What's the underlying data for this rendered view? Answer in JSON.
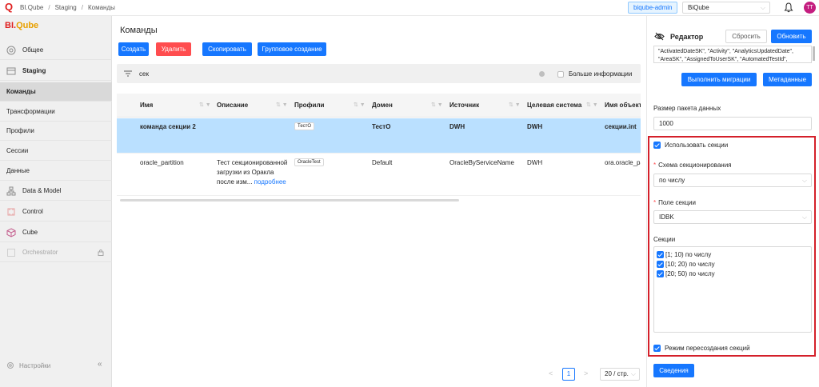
{
  "header": {
    "logo": "Q",
    "breadcrumb": [
      "BI.Qube",
      "Staging",
      "Команды"
    ],
    "admin_tag": "biqube-admin",
    "workspace": "BiQube",
    "avatar_initials": "TT"
  },
  "sidebar": {
    "brand_a": "BI.",
    "brand_b": "Qube",
    "items": [
      {
        "label": "Общее"
      },
      {
        "label": "Staging"
      },
      {
        "label": "Команды"
      },
      {
        "label": "Трансформации"
      },
      {
        "label": "Профили"
      },
      {
        "label": "Сессии"
      },
      {
        "label": "Данные"
      },
      {
        "label": "Data & Model"
      },
      {
        "label": "Control"
      },
      {
        "label": "Cube"
      },
      {
        "label": "Orchestrator"
      }
    ],
    "settings": "Настройки",
    "collapse": "«"
  },
  "main": {
    "title": "Команды",
    "toolbar": {
      "create": "Создать",
      "delete": "Удалить",
      "copy": "Скопировать",
      "group_create": "Групповое создание"
    },
    "search_value": "сек",
    "more_info": "Больше информации",
    "columns": [
      "Имя",
      "Описание",
      "Профили",
      "Домен",
      "Источник",
      "Целевая система",
      "Имя объекта"
    ],
    "rows": [
      {
        "name": "команда секции 2",
        "description": "",
        "profile": "ТестО",
        "domain": "ТестО",
        "source": "DWH",
        "target": "DWH",
        "object": "секции.int"
      },
      {
        "name": "oracle_partition",
        "description_1": "Тест секционированной",
        "description_2": "загрузки из Оракла",
        "description_3": "после изм...",
        "more": "подробнее",
        "profile": "OracleTest",
        "domain": "Default",
        "source": "OracleByServiceName",
        "target": "DWH",
        "object": "ora.oracle_pa"
      }
    ],
    "pagination": {
      "prev": "<",
      "page": "1",
      "next": ">",
      "page_size": "20 / стр."
    }
  },
  "editor": {
    "title": "Редактор",
    "reset": "Сбросить",
    "update": "Обновить",
    "code_line_1": "\"ActivatedDateSK\", \"Activity\", \"AnalyticsUpdatedDate\",",
    "code_line_2": "\"AreaSK\", \"AssignedToUserSK\", \"AutomatedTestId\",",
    "run_migrations": "Выполнить миграции",
    "metadata": "Метаданные",
    "batch_size_label": "Размер пакета данных",
    "batch_size_value": "1000",
    "use_sections": "Использовать секции",
    "scheme_label": "Схема секционирования",
    "scheme_value": "по числу",
    "field_label": "Поле секции",
    "field_value": "IDBK",
    "sections_label": "Секции",
    "sections": [
      "[1; 10) по числу",
      "[10; 20) по числу",
      "[20; 50) по числу"
    ],
    "recreate_mode": "Режим пересоздания секций",
    "summary": "Сведения",
    "required_mark": "*"
  },
  "colors": {
    "accent": "#1677ff",
    "danger": "#ff4d4f",
    "highlight_border": "#d4202a",
    "selected_row": "#bae0ff"
  }
}
